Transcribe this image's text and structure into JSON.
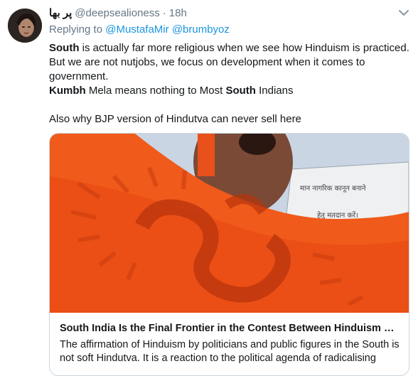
{
  "tweet": {
    "author_name": "پر بها",
    "handle": "@deepsealioness",
    "separator": "·",
    "time": "18h",
    "replying_prefix": "Replying to",
    "replying_to": [
      "@MustafaMir",
      "@brumbyoz"
    ],
    "segments": {
      "s1_bold": "South",
      "s1_rest": " is actually far more religious when we see how Hinduism is practiced. But we are not nutjobs, we focus on development when it comes to government.",
      "s2_bold1": "Kumbh",
      "s2_mid": " Mela means nothing to Most ",
      "s2_bold2": "South",
      "s2_end": " Indians",
      "s3": "Also why BJP version of Hindutva can never sell here"
    }
  },
  "card": {
    "image_sign_line1": "मान नागरिक कानून बनाने",
    "image_sign_line2": "हेतु मतदान करें।",
    "title": "South India Is the Final Frontier in the Contest Between Hinduism and Hindutva",
    "description": "The affirmation of Hinduism by politicians and public figures in the South is not soft Hindutva. It is a reaction to the political agenda of radicalising"
  },
  "icons": {
    "menu": "chevron-down-icon"
  },
  "colors": {
    "link": "#1b95e0",
    "secondary": "#657786",
    "saffron": "#f05a1a"
  }
}
